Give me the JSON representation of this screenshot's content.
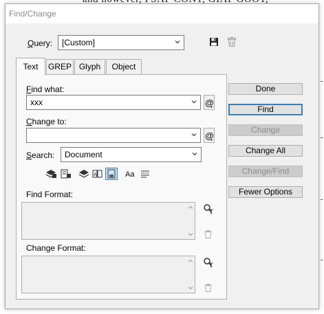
{
  "background_text": "and however, PSAF CONT, GIAP GOOT,",
  "dialog": {
    "title": "Find/Change",
    "query": {
      "label": "Query:",
      "value": "[Custom]"
    },
    "tabs": [
      {
        "label": "Text",
        "active": true
      },
      {
        "label": "GREP",
        "active": false
      },
      {
        "label": "Glyph",
        "active": false
      },
      {
        "label": "Object",
        "active": false
      }
    ],
    "find_what": {
      "label": "Find what:",
      "value": "xxx"
    },
    "change_to": {
      "label": "Change to:",
      "value": ""
    },
    "search": {
      "label": "Search:",
      "value": "Document"
    },
    "options_row": {
      "case_label": "Aa"
    },
    "find_format": {
      "label": "Find Format:"
    },
    "change_format": {
      "label": "Change Format:"
    },
    "buttons": {
      "done": "Done",
      "find": "Find",
      "change": "Change",
      "change_all": "Change All",
      "change_find": "Change/Find",
      "fewer_options": "Fewer Options"
    },
    "colors": {
      "focus_border": "#3c7fb1",
      "dialog_bg": "#f0f0f0",
      "disabled_text": "#8d8d8d"
    }
  }
}
